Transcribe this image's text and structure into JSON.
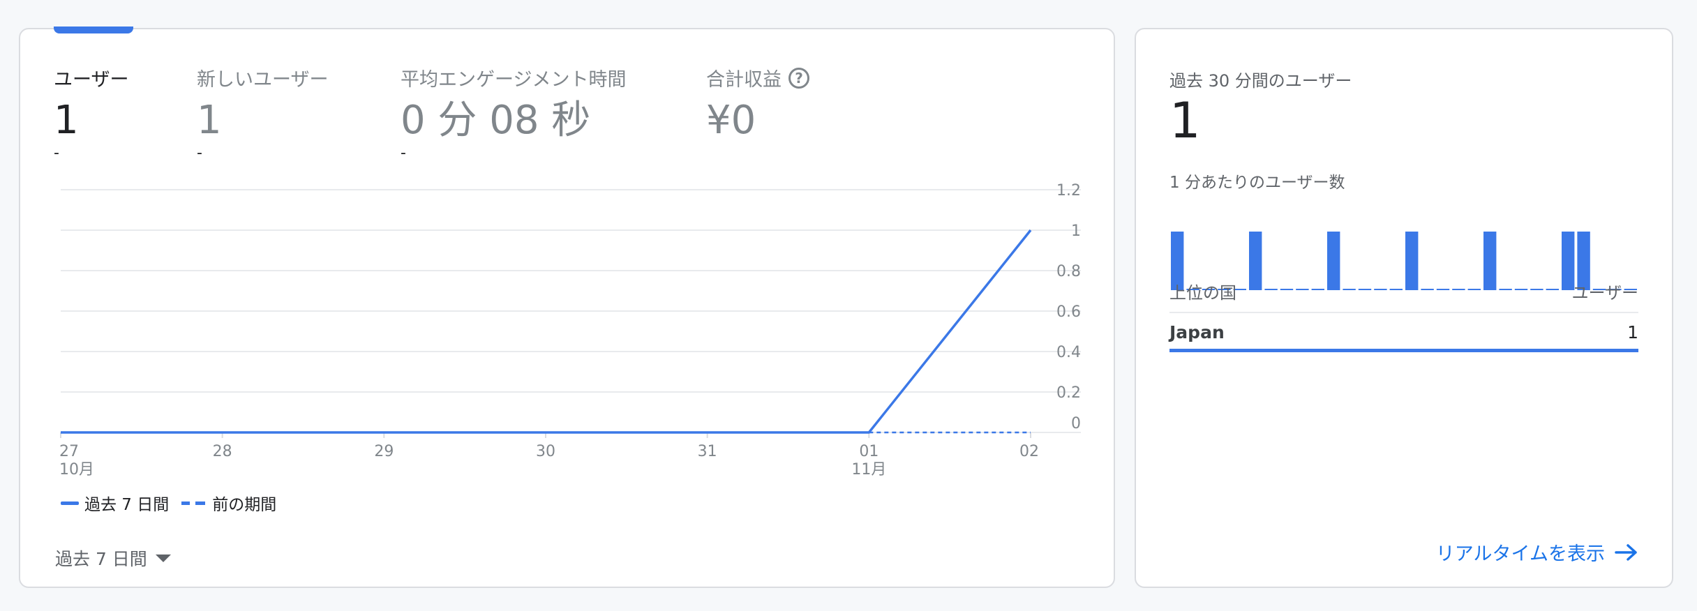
{
  "main_card": {
    "metrics": [
      {
        "label": "ユーザー",
        "value": "1",
        "delta": "-"
      },
      {
        "label": "新しいユーザー",
        "value": "1",
        "delta": "-"
      },
      {
        "label": "平均エンゲージメント時間",
        "value": "0 分 08 秒",
        "delta": "-"
      },
      {
        "label": "合計収益",
        "value": "¥0",
        "help_icon": "help-circle-icon"
      }
    ],
    "legend": {
      "current": "過去 7 日間",
      "previous": "前の期間"
    },
    "date_range": "過去 7 日間"
  },
  "chart_data": {
    "type": "line",
    "x": [
      "27\n10月",
      "28",
      "29",
      "30",
      "31",
      "01\n11月",
      "02"
    ],
    "series": [
      {
        "name": "過去 7 日間",
        "values": [
          0,
          0,
          0,
          0,
          0,
          0,
          1
        ],
        "style": "solid"
      },
      {
        "name": "前の期間",
        "values": [
          0,
          0,
          0,
          0,
          0,
          0,
          0
        ],
        "style": "dashed"
      }
    ],
    "yticks": [
      "1.2",
      "1",
      "0.8",
      "0.6",
      "0.4",
      "0.2",
      "0"
    ],
    "ylim": [
      0,
      1.2
    ],
    "y_axis_side": "right",
    "grid": true,
    "legend_position": "bottom-left",
    "color": "#3b78e7"
  },
  "realtime_card": {
    "title": "過去 30 分間のユーザー",
    "value": "1",
    "per_minute_label": "1 分あたりのユーザー数",
    "per_minute_values": [
      1,
      0,
      0,
      0,
      0,
      1,
      0,
      0,
      0,
      0,
      1,
      0,
      0,
      0,
      0,
      1,
      0,
      0,
      0,
      0,
      1,
      0,
      0,
      0,
      0,
      1,
      1,
      0,
      0,
      0
    ],
    "table_header": {
      "dimension": "上位の国",
      "metric": "ユーザー"
    },
    "rows": [
      {
        "country": "Japan",
        "users": "1",
        "share": 1.0
      }
    ],
    "link": "リアルタイムを表示",
    "link_icon": "arrow-right-icon"
  },
  "colors": {
    "accent": "#3b78e7",
    "link": "#1a73e8",
    "muted": "#80868b"
  }
}
